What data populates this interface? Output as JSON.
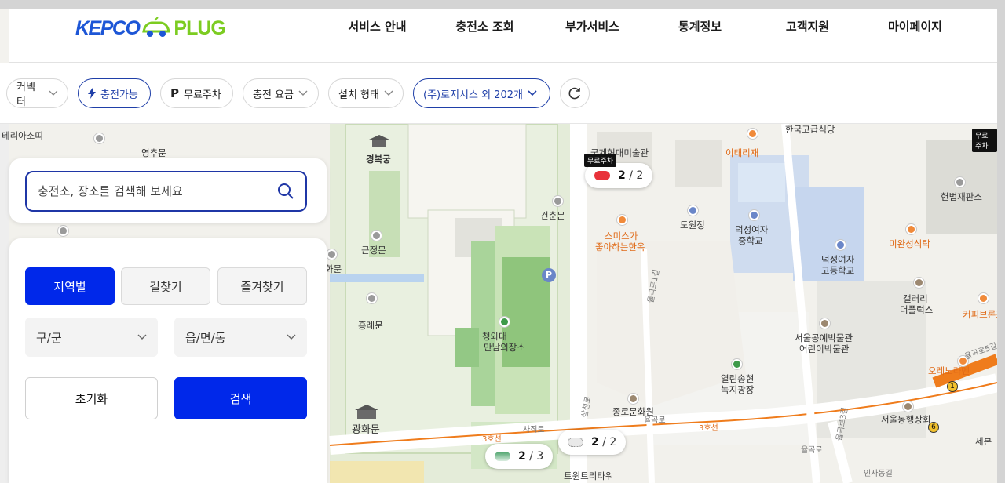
{
  "header": {
    "logo_left": "KEPCO",
    "logo_right": "PLUG",
    "nav": [
      "서비스 안내",
      "충전소 조회",
      "부가서비스",
      "통계정보",
      "고객지원",
      "마이페이지"
    ]
  },
  "filters": {
    "connector": "커넥터",
    "chargeable": "충전가능",
    "free_parking": "무료주차",
    "parking_glyph": "P",
    "fee": "충전 요금",
    "install_type": "설치 형태",
    "operator": "(주)로지시스 외 202개"
  },
  "search": {
    "placeholder": "충전소, 장소를 검색해 보세요"
  },
  "panel": {
    "tabs": [
      "지역별",
      "길찾기",
      "즐겨찾기"
    ],
    "active_tab": 0,
    "select_district": "구/군",
    "select_town": "읍/면/동",
    "reset_label": "초기화",
    "search_label": "검색"
  },
  "map": {
    "labels": {
      "top_left": "테리아소띠",
      "yeongchumun": "영추문",
      "gyeongbokgung": "경복궁",
      "geunjeongmun": "근정문",
      "hwamun": "화문",
      "heungnyemun": "흥례문",
      "gwanghwamun": "광화문",
      "geonchunmun": "건춘문",
      "cheongwadae": "청와대",
      "cheongwadae2": "만남의장소",
      "gallery": "국제현대미술관",
      "itaeri": "이태리재",
      "dowonjeong": "도원정",
      "smisu": "스미스가",
      "smisu2": "좋아하는한옥",
      "deokseong_mid": "덕성여자",
      "deokseong_mid2": "중학교",
      "deokseong_high": "덕성여자",
      "deokseong_high2": "고등학교",
      "court": "헌법재판소",
      "miwan": "미완성식탁",
      "gallery2": "갤러리",
      "gallery2b": "더플럭스",
      "coffee": "커피브론즈",
      "museum": "서울공예박물관",
      "museum2": "어린이박물관",
      "park": "열린송현",
      "park2": "녹지광장",
      "jongno_post": "종로문화원",
      "orenorame": "오레노라멘",
      "dongyang": "서울동행상회",
      "sejong": "세본",
      "twin": "트윈트리타워",
      "road_sajik": "사직로",
      "road_yulgok": "율곡로",
      "road_samcheong": "삼청로",
      "line3a": "3호선",
      "line3b": "3호선",
      "yulgok_street": "율곡로1길",
      "topstore": "한국고급식당",
      "insadong": "인사동길",
      "yulgok3": "율곡로3길",
      "yulgok5": "율곡로5길",
      "free_tag": "무료주차",
      "station_badge_1": "1",
      "station_badge_6": "6"
    },
    "stations": [
      {
        "available": "2",
        "total": "/ 2",
        "tag": "무료주차",
        "color": "#e8323a"
      },
      {
        "available": "2",
        "total": "/ 2",
        "tag": "",
        "color": "#888888"
      },
      {
        "available": "2",
        "total": "/ 3",
        "tag": "",
        "color": "#4aa36a"
      }
    ],
    "colors": {
      "accent": "#0028ea",
      "navy": "#1f36a6",
      "line3": "#ef7c1c",
      "green": "#d6e9cc",
      "water": "#b9d3ef"
    }
  }
}
